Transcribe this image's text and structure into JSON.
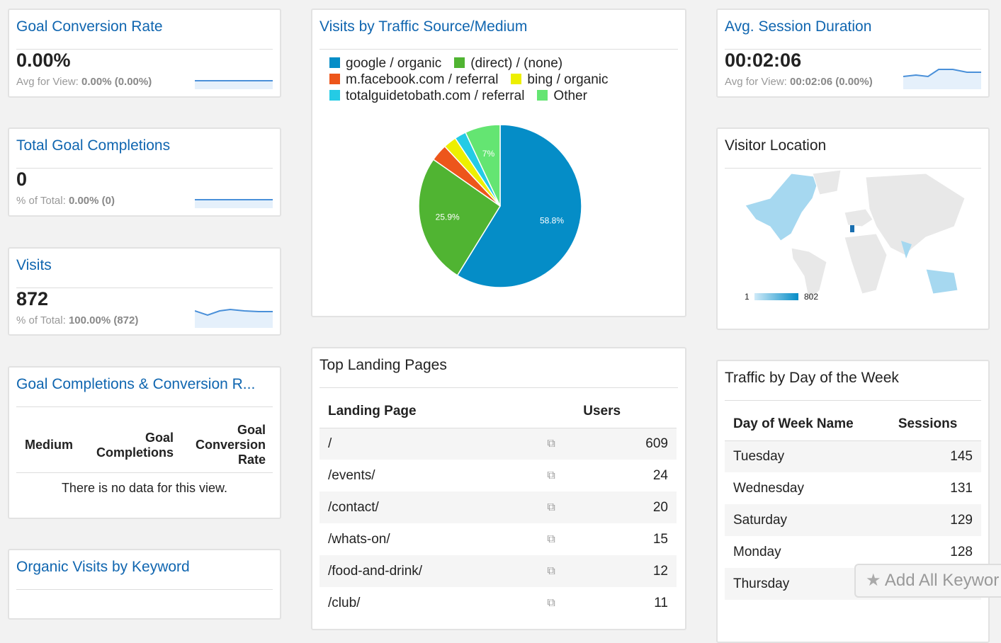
{
  "goal_conversion": {
    "title": "Goal Conversion Rate",
    "value": "0.00%",
    "sub_label": "Avg for View:",
    "sub_value": "0.00% (0.00%)"
  },
  "goal_completions": {
    "title": "Total Goal Completions",
    "value": "0",
    "sub_label": "% of Total:",
    "sub_value": "0.00% (0)"
  },
  "visits": {
    "title": "Visits",
    "value": "872",
    "sub_label": "% of Total:",
    "sub_value": "100.00% (872)"
  },
  "goal_table": {
    "title": "Goal Completions & Conversion R...",
    "headers": [
      "Medium",
      "Goal Completions",
      "Goal Conversion Rate"
    ],
    "empty": "There is no data for this view."
  },
  "organic": {
    "title": "Organic Visits by Keyword"
  },
  "traffic_source": {
    "title": "Visits by Traffic Source/Medium"
  },
  "chart_data": {
    "type": "pie",
    "title": "Visits by Traffic Source/Medium",
    "legend": "top",
    "labels": [
      "google / organic",
      "(direct) / (none)",
      "m.facebook.com / referral",
      "bing / organic",
      "totalguidetobath.com / referral",
      "Other"
    ],
    "values": [
      58.8,
      25.9,
      3.4,
      2.6,
      2.3,
      7.0
    ],
    "data_labels": [
      "58.8%",
      "25.9%",
      "",
      "",
      "",
      "7%"
    ],
    "colors": [
      "#058dc7",
      "#50b432",
      "#ed561b",
      "#edef00",
      "#24cbe5",
      "#64e572"
    ]
  },
  "landing": {
    "title": "Top Landing Pages",
    "headers": [
      "Landing Page",
      "Users"
    ],
    "rows": [
      {
        "page": "/",
        "users": "609"
      },
      {
        "page": "/events/",
        "users": "24"
      },
      {
        "page": "/contact/",
        "users": "20"
      },
      {
        "page": "/whats-on/",
        "users": "15"
      },
      {
        "page": "/food-and-drink/",
        "users": "12"
      },
      {
        "page": "/club/",
        "users": "11"
      }
    ]
  },
  "session": {
    "title": "Avg. Session Duration",
    "value": "00:02:06",
    "sub_label": "Avg for View:",
    "sub_value": "00:02:06 (0.00%)"
  },
  "location": {
    "title": "Visitor Location",
    "min": "1",
    "max": "802"
  },
  "week": {
    "title": "Traffic by Day of the Week",
    "headers": [
      "Day of Week Name",
      "Sessions"
    ],
    "rows": [
      {
        "day": "Tuesday",
        "sessions": "145"
      },
      {
        "day": "Wednesday",
        "sessions": "131"
      },
      {
        "day": "Saturday",
        "sessions": "129"
      },
      {
        "day": "Monday",
        "sessions": "128"
      },
      {
        "day": "Thursday",
        "sessions": ""
      }
    ]
  },
  "add_button": "Add All Keywor"
}
